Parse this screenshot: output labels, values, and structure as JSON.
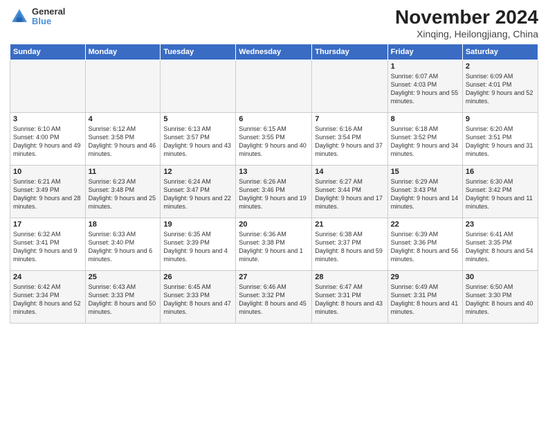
{
  "logo": {
    "line1": "General",
    "line2": "Blue"
  },
  "title": "November 2024",
  "subtitle": "Xinqing, Heilongjiang, China",
  "days_of_week": [
    "Sunday",
    "Monday",
    "Tuesday",
    "Wednesday",
    "Thursday",
    "Friday",
    "Saturday"
  ],
  "weeks": [
    [
      {
        "day": "",
        "info": ""
      },
      {
        "day": "",
        "info": ""
      },
      {
        "day": "",
        "info": ""
      },
      {
        "day": "",
        "info": ""
      },
      {
        "day": "",
        "info": ""
      },
      {
        "day": "1",
        "info": "Sunrise: 6:07 AM\nSunset: 4:03 PM\nDaylight: 9 hours and 55 minutes."
      },
      {
        "day": "2",
        "info": "Sunrise: 6:09 AM\nSunset: 4:01 PM\nDaylight: 9 hours and 52 minutes."
      }
    ],
    [
      {
        "day": "3",
        "info": "Sunrise: 6:10 AM\nSunset: 4:00 PM\nDaylight: 9 hours and 49 minutes."
      },
      {
        "day": "4",
        "info": "Sunrise: 6:12 AM\nSunset: 3:58 PM\nDaylight: 9 hours and 46 minutes."
      },
      {
        "day": "5",
        "info": "Sunrise: 6:13 AM\nSunset: 3:57 PM\nDaylight: 9 hours and 43 minutes."
      },
      {
        "day": "6",
        "info": "Sunrise: 6:15 AM\nSunset: 3:55 PM\nDaylight: 9 hours and 40 minutes."
      },
      {
        "day": "7",
        "info": "Sunrise: 6:16 AM\nSunset: 3:54 PM\nDaylight: 9 hours and 37 minutes."
      },
      {
        "day": "8",
        "info": "Sunrise: 6:18 AM\nSunset: 3:52 PM\nDaylight: 9 hours and 34 minutes."
      },
      {
        "day": "9",
        "info": "Sunrise: 6:20 AM\nSunset: 3:51 PM\nDaylight: 9 hours and 31 minutes."
      }
    ],
    [
      {
        "day": "10",
        "info": "Sunrise: 6:21 AM\nSunset: 3:49 PM\nDaylight: 9 hours and 28 minutes."
      },
      {
        "day": "11",
        "info": "Sunrise: 6:23 AM\nSunset: 3:48 PM\nDaylight: 9 hours and 25 minutes."
      },
      {
        "day": "12",
        "info": "Sunrise: 6:24 AM\nSunset: 3:47 PM\nDaylight: 9 hours and 22 minutes."
      },
      {
        "day": "13",
        "info": "Sunrise: 6:26 AM\nSunset: 3:46 PM\nDaylight: 9 hours and 19 minutes."
      },
      {
        "day": "14",
        "info": "Sunrise: 6:27 AM\nSunset: 3:44 PM\nDaylight: 9 hours and 17 minutes."
      },
      {
        "day": "15",
        "info": "Sunrise: 6:29 AM\nSunset: 3:43 PM\nDaylight: 9 hours and 14 minutes."
      },
      {
        "day": "16",
        "info": "Sunrise: 6:30 AM\nSunset: 3:42 PM\nDaylight: 9 hours and 11 minutes."
      }
    ],
    [
      {
        "day": "17",
        "info": "Sunrise: 6:32 AM\nSunset: 3:41 PM\nDaylight: 9 hours and 9 minutes."
      },
      {
        "day": "18",
        "info": "Sunrise: 6:33 AM\nSunset: 3:40 PM\nDaylight: 9 hours and 6 minutes."
      },
      {
        "day": "19",
        "info": "Sunrise: 6:35 AM\nSunset: 3:39 PM\nDaylight: 9 hours and 4 minutes."
      },
      {
        "day": "20",
        "info": "Sunrise: 6:36 AM\nSunset: 3:38 PM\nDaylight: 9 hours and 1 minute."
      },
      {
        "day": "21",
        "info": "Sunrise: 6:38 AM\nSunset: 3:37 PM\nDaylight: 8 hours and 59 minutes."
      },
      {
        "day": "22",
        "info": "Sunrise: 6:39 AM\nSunset: 3:36 PM\nDaylight: 8 hours and 56 minutes."
      },
      {
        "day": "23",
        "info": "Sunrise: 6:41 AM\nSunset: 3:35 PM\nDaylight: 8 hours and 54 minutes."
      }
    ],
    [
      {
        "day": "24",
        "info": "Sunrise: 6:42 AM\nSunset: 3:34 PM\nDaylight: 8 hours and 52 minutes."
      },
      {
        "day": "25",
        "info": "Sunrise: 6:43 AM\nSunset: 3:33 PM\nDaylight: 8 hours and 50 minutes."
      },
      {
        "day": "26",
        "info": "Sunrise: 6:45 AM\nSunset: 3:33 PM\nDaylight: 8 hours and 47 minutes."
      },
      {
        "day": "27",
        "info": "Sunrise: 6:46 AM\nSunset: 3:32 PM\nDaylight: 8 hours and 45 minutes."
      },
      {
        "day": "28",
        "info": "Sunrise: 6:47 AM\nSunset: 3:31 PM\nDaylight: 8 hours and 43 minutes."
      },
      {
        "day": "29",
        "info": "Sunrise: 6:49 AM\nSunset: 3:31 PM\nDaylight: 8 hours and 41 minutes."
      },
      {
        "day": "30",
        "info": "Sunrise: 6:50 AM\nSunset: 3:30 PM\nDaylight: 8 hours and 40 minutes."
      }
    ]
  ]
}
